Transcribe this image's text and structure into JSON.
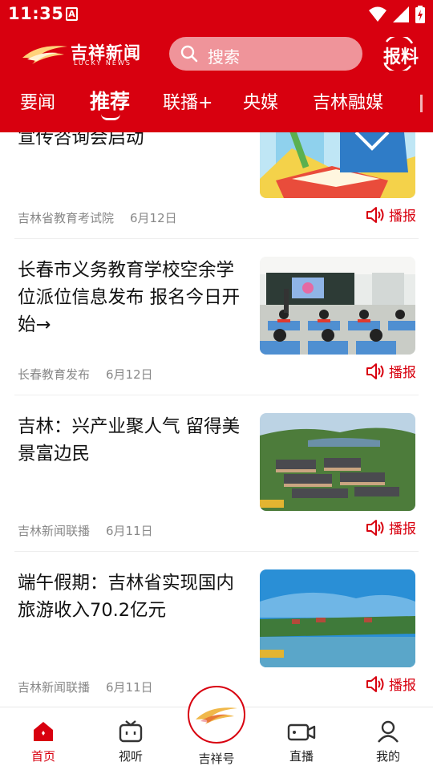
{
  "status_bar": {
    "time": "11:35",
    "notif_letter": "A"
  },
  "header": {
    "logo_title": "吉祥新闻",
    "logo_subtitle": "LUCKY NEWS",
    "search_placeholder": "搜索",
    "report_label": "报料"
  },
  "tabs": [
    {
      "label": "要闻",
      "active": false
    },
    {
      "label": "推荐",
      "active": true
    },
    {
      "label": "联播+",
      "active": false
    },
    {
      "label": "央媒",
      "active": false
    },
    {
      "label": "吉林融媒",
      "active": false
    }
  ],
  "feed": {
    "play_label": "播报",
    "items": [
      {
        "title": "宣传咨询会启动",
        "source": "吉林省教育考试院",
        "date": "6月12日",
        "thumb": "thumb-education-illustration"
      },
      {
        "title": "长春市义务教育学校空余学位派位信息发布 报名今日开始→",
        "source": "长春教育发布",
        "date": "6月12日",
        "thumb": "thumb-classroom"
      },
      {
        "title": "吉林：兴产业聚人气 留得美景富边民",
        "source": "吉林新闻联播",
        "date": "6月11日",
        "thumb": "thumb-village-aerial"
      },
      {
        "title": "端午假期：吉林省实现国内旅游收入70.2亿元",
        "source": "吉林新闻联播",
        "date": "6月11日",
        "thumb": "thumb-lake-scenery"
      }
    ]
  },
  "bottom_nav": {
    "home": "首页",
    "video": "视听",
    "center": "吉祥号",
    "live": "直播",
    "mine": "我的"
  },
  "colors": {
    "brand_red": "#d8000f",
    "meta_gray": "#888888"
  }
}
